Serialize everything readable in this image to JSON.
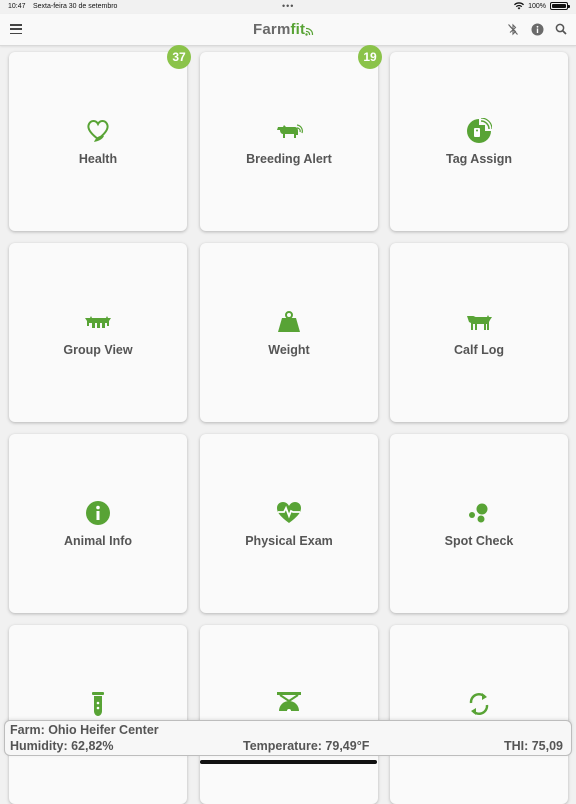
{
  "status": {
    "time": "10:47",
    "date": "Sexta-feira 30 de setembro",
    "battery": "100%"
  },
  "header": {
    "logo_main": "Farm",
    "logo_accent": "fit"
  },
  "tiles": [
    {
      "label": "Health",
      "icon": "heart-leaf-icon",
      "badge": "37"
    },
    {
      "label": "Breeding Alert",
      "icon": "cow-breeding-icon",
      "badge": "19"
    },
    {
      "label": "Tag Assign",
      "icon": "rfid-tag-icon",
      "badge": null
    },
    {
      "label": "Group View",
      "icon": "cattle-group-icon",
      "badge": null
    },
    {
      "label": "Weight",
      "icon": "weight-icon",
      "badge": null
    },
    {
      "label": "Calf Log",
      "icon": "calf-icon",
      "badge": null
    },
    {
      "label": "Animal Info",
      "icon": "info-circle-icon",
      "badge": null
    },
    {
      "label": "Physical Exam",
      "icon": "heart-pulse-icon",
      "badge": null
    },
    {
      "label": "Spot Check",
      "icon": "dots-icon",
      "badge": null
    },
    {
      "label": "",
      "icon": "test-tube-icon",
      "badge": null
    },
    {
      "label": "",
      "icon": "scale-hook-icon",
      "badge": null
    },
    {
      "label": "",
      "icon": "sync-icon",
      "badge": null
    }
  ],
  "footer": {
    "farm": "Farm: Ohio Heifer Center",
    "humidity": "Humidity: 62,82%",
    "temperature": "Temperature: 79,49°F",
    "thi": "THI: 75,09"
  },
  "colors": {
    "accent": "#58a335",
    "badge": "#8bc34a",
    "text": "#555555"
  }
}
